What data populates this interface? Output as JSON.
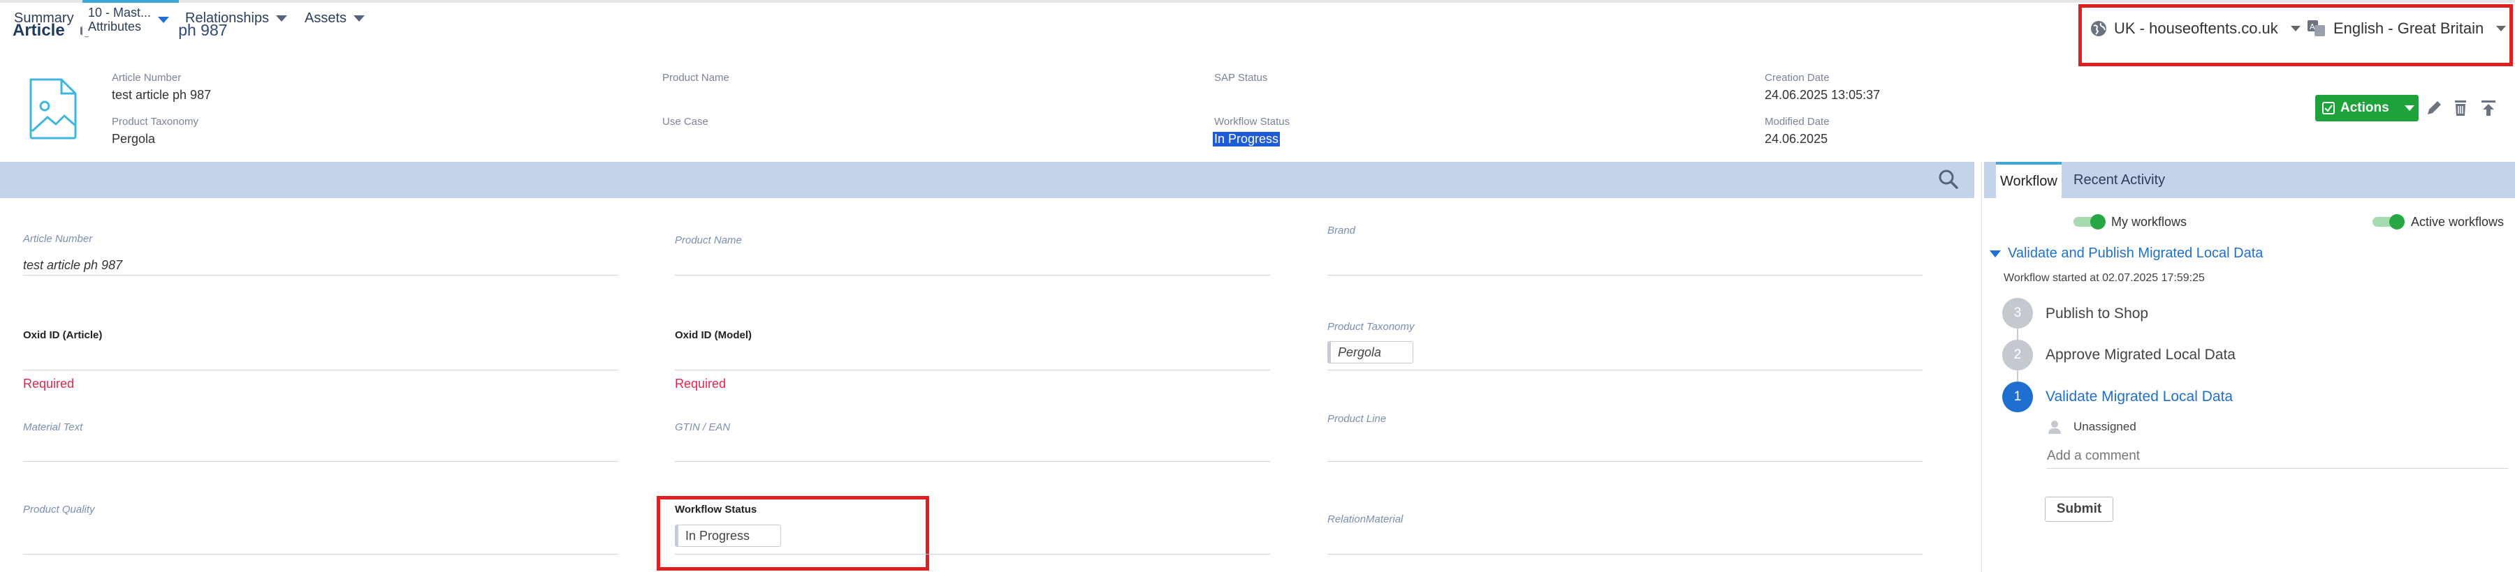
{
  "header": {
    "title": "Article",
    "object_name": "test article ph 987",
    "context": "UK - houseoftents.co.uk",
    "language": "English - Great Britain"
  },
  "metadata": [
    {
      "label": "Article Number",
      "value": "test article ph 987"
    },
    {
      "label": "Product Name",
      "value": ""
    },
    {
      "label": "SAP Status",
      "value": ""
    },
    {
      "label": "Creation Date",
      "value": "24.06.2025 13:05:37"
    },
    {
      "label": "Product Taxonomy",
      "value": "Pergola"
    },
    {
      "label": "Use Case",
      "value": ""
    },
    {
      "label": "Workflow Status",
      "value": "In Progress"
    },
    {
      "label": "Modified Date",
      "value": "24.06.2025"
    }
  ],
  "toolbar": {
    "actions_label": "Actions",
    "icons": [
      "edit-icon",
      "delete-icon",
      "publish-icon"
    ]
  },
  "tabs": [
    {
      "label": "Summary"
    },
    {
      "label_line1": "10 - Mast...",
      "label_line2": "Attributes"
    },
    {
      "label": "Relationships"
    },
    {
      "label": "Assets"
    }
  ],
  "fields": {
    "article_number": {
      "label": "Article Number",
      "value": "test article ph 987"
    },
    "product_name": {
      "label": "Product Name"
    },
    "brand": {
      "label": "Brand"
    },
    "oxid_article": {
      "label": "Oxid ID (Article)",
      "required": "Required"
    },
    "oxid_model": {
      "label": "Oxid ID (Model)",
      "required": "Required"
    },
    "product_taxonomy": {
      "label": "Product Taxonomy",
      "value": "Pergola"
    },
    "material_text": {
      "label": "Material Text"
    },
    "gtin_ean": {
      "label": "GTIN / EAN"
    },
    "product_line": {
      "label": "Product Line"
    },
    "product_quality": {
      "label": "Product Quality"
    },
    "workflow_status": {
      "label": "Workflow Status",
      "value": "In Progress"
    },
    "relation_material": {
      "label": "RelationMaterial"
    }
  },
  "workflow_panel": {
    "tabs": [
      "Workflow",
      "Recent Activity"
    ],
    "toggles": [
      {
        "label": "My workflows",
        "on": true
      },
      {
        "label": "Active workflows",
        "on": true
      }
    ],
    "workflow_title": "Validate and Publish Migrated Local Data",
    "started": "Workflow started at 02.07.2025 17:59:25",
    "steps": [
      {
        "num": "3",
        "label": "Publish to Shop"
      },
      {
        "num": "2",
        "label": "Approve Migrated Local Data"
      },
      {
        "num": "1",
        "label": "Validate Migrated Local Data"
      }
    ],
    "assignee": "Unassigned",
    "comment_placeholder": "Add a comment",
    "submit_label": "Submit"
  },
  "colors": {
    "accent": "#1e6fd0",
    "tab_bar": "#c5d3ea",
    "success": "#1ea33b",
    "required": "#e0264f",
    "highlight_frame": "#e02020"
  }
}
